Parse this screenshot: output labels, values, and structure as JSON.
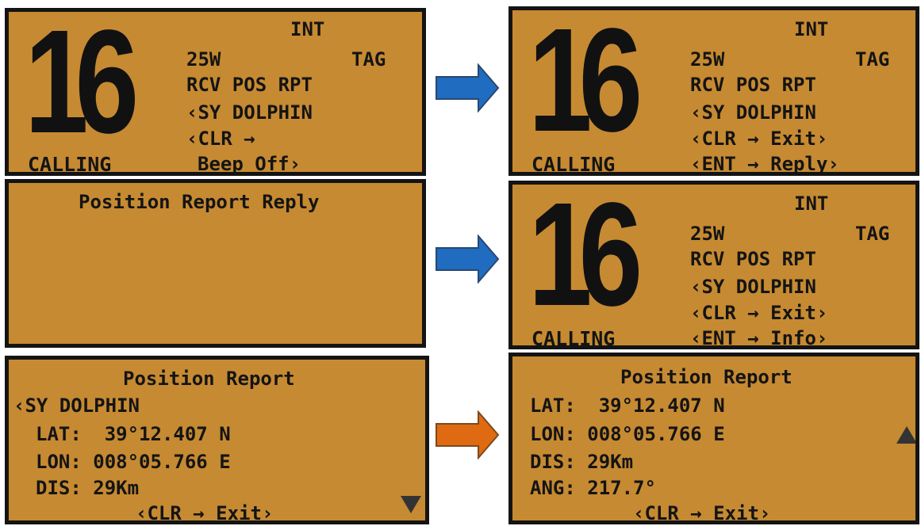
{
  "colors": {
    "lcd_background": "#c68a32",
    "lcd_text": "#141414",
    "arrow_blue": "#1f6cc0",
    "arrow_orange": "#e06a12",
    "frame": "#141414"
  },
  "panels": {
    "p1": {
      "channel": "16",
      "int": "INT",
      "power": "25W",
      "tag": "TAG",
      "line1": "RCV POS RPT",
      "line2": "‹SY DOLPHIN",
      "line3": "‹CLR →",
      "line4": "Beep Off›",
      "mode": "CALLING"
    },
    "p2": {
      "channel": "16",
      "int": "INT",
      "power": "25W",
      "tag": "TAG",
      "line1": "RCV POS RPT",
      "line2": "‹SY DOLPHIN",
      "line3": "‹CLR → Exit›",
      "line4": "‹ENT → Reply›",
      "mode": "CALLING"
    },
    "p3": {
      "title": "Position Report Reply"
    },
    "p4": {
      "channel": "16",
      "int": "INT",
      "power": "25W",
      "tag": "TAG",
      "line1": "RCV POS RPT",
      "line2": "‹SY DOLPHIN",
      "line3": "‹CLR → Exit›",
      "line4": "‹ENT → Info›",
      "mode": "CALLING"
    },
    "p5": {
      "title": "Position Report",
      "name": "‹SY DOLPHIN",
      "lat": "LAT:  39°12.407 N",
      "lon": "LON: 008°05.766 E",
      "dis": "DIS: 29Km",
      "footer": "‹CLR → Exit›",
      "scroll_icon": "triangle-down-icon"
    },
    "p6": {
      "title": "Position Report",
      "lat": "LAT:  39°12.407 N",
      "lon": "LON: 008°05.766 E",
      "dis": "DIS: 29Km",
      "ang": "ANG: 217.7°",
      "footer": "‹CLR → Exit›",
      "scroll_icon": "triangle-up-icon"
    }
  },
  "arrows": [
    {
      "name": "arrow-right-icon",
      "color": "blue"
    },
    {
      "name": "arrow-right-icon",
      "color": "blue"
    },
    {
      "name": "arrow-right-icon",
      "color": "orange"
    }
  ]
}
